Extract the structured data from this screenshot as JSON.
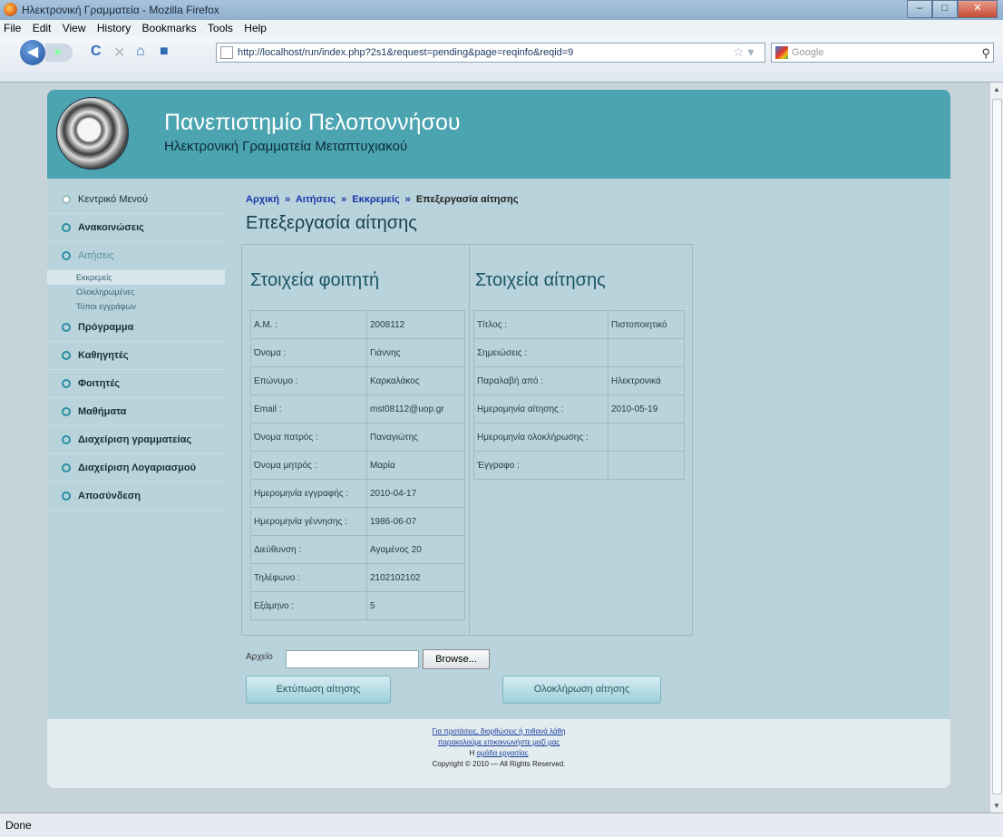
{
  "window": {
    "title": "Ηλεκτρονική Γραμματεία - Mozilla Firefox",
    "min": "–",
    "max": "□",
    "close": "✕"
  },
  "menu": [
    "File",
    "Edit",
    "View",
    "History",
    "Bookmarks",
    "Tools",
    "Help"
  ],
  "toolbar": {
    "url": "http://localhost/run/index.php?2s1&request=pending&page=reqinfo&reqid=9",
    "search_placeholder": "Google"
  },
  "status": "Done",
  "header": {
    "title": "Πανεπιστημίο Πελοποννήσου",
    "subtitle": "Ηλεκτρονική Γραμματεία Μεταπτυχιακού"
  },
  "sidebar": {
    "home": "Κεντρικό Μενού",
    "announcements": "Ανακοινώσεις",
    "requests": "Αιτήσεις",
    "sub": [
      "Εκκρεμείς",
      "Ολοκληρωμένες",
      "Τύποι εγγράφων"
    ],
    "items": [
      "Πρόγραμμα",
      "Καθηγητές",
      "Φοιτητές",
      "Μαθήματα",
      "Διαχείριση γραμματείας",
      "Διαχείριση Λογαριασμού",
      "Αποσύνδεση"
    ]
  },
  "breadcrumb": {
    "home": "Αρχική",
    "sep": "»",
    "requests": "Αιτήσεις",
    "pending": "Εκκρεμείς",
    "current": "Επεξεργασία αίτησης"
  },
  "page_title": "Επεξεργασία αίτησης",
  "student": {
    "title": "Στοιχεία φοιτητή",
    "rows": [
      [
        "Α.Μ. :",
        "2008112"
      ],
      [
        "Όνομα :",
        "Γιάννης"
      ],
      [
        "Επώνυμο :",
        "Καρκαλάκος"
      ],
      [
        "Email :",
        "mst08112@uop.gr"
      ],
      [
        "Όνομα πατρός :",
        "Παναγιώτης"
      ],
      [
        "Όνομα μητρός :",
        "Μαρία"
      ],
      [
        "Ημερομηνία εγγραφής :",
        "2010-04-17"
      ],
      [
        "Ημερομηνία γέννησης :",
        "1986-06-07"
      ],
      [
        "Διεύθυνση :",
        "Αγαμένος 20"
      ],
      [
        "Τηλέφωνο :",
        "2102102102"
      ],
      [
        "Εξάμηνο :",
        "5"
      ]
    ]
  },
  "request": {
    "title": "Στοιχεία αίτησης",
    "rows": [
      [
        "Τίτλος :",
        "Πιστοποιητικό"
      ],
      [
        "Σημειώσεις :",
        ""
      ],
      [
        "Παραλαβή από :",
        "Ηλεκτρονικά"
      ],
      [
        "Ημερομηνία αίτησης :",
        "2010-05-19"
      ],
      [
        "Ημερομηνία ολοκλήρωσης :",
        ""
      ],
      [
        "Έγγραφο :",
        ""
      ]
    ]
  },
  "file": {
    "label": "Αρχείο",
    "browse": "Browse..."
  },
  "buttons": {
    "print": "Εκτύπωση αίτησης",
    "complete": "Ολοκλήρωση αίτησης"
  },
  "footer": {
    "line1": "Για προτάσεις, διορθώσεις ή πιθανά λάθη",
    "line2": "παρακαλούμε επικοινωνήστε μαζί μας",
    "line3a": "Η",
    "line3b": "ομάδα εργασίας",
    "line4": "Copyright © 2010 — All Rights Reserved."
  }
}
